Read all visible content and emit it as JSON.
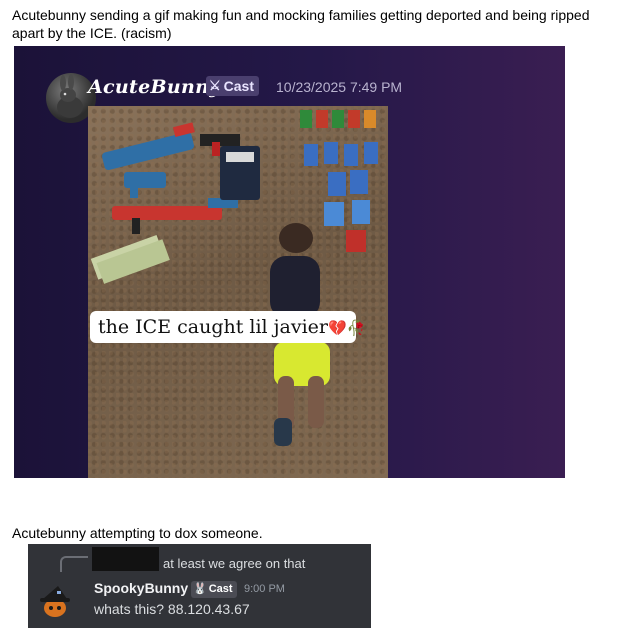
{
  "captions": {
    "first": "Acutebunny sending a gif making fun and mocking families getting deported and being ripped apart by the ICE. (racism)",
    "second": "Acutebunny attempting to dox someone."
  },
  "screenshot1": {
    "username": "AcuteBunny",
    "badge_label": "Cast",
    "badge_icon": "sword-icon",
    "timestamp": "10/23/2025 7:49 PM",
    "gif_caption": "the ICE caught lil javier",
    "gif_caption_emojis": "💔🥀",
    "colors": {
      "background": "#241848",
      "badge": "#4a3f6e"
    }
  },
  "screenshot2": {
    "reply_text": "at least we agree on that",
    "username": "SpookyBunny",
    "badge_label": "Cast",
    "badge_icon": "bunny-icon",
    "timestamp": "9:00 PM",
    "message": "whats this? 88.120.43.67",
    "colors": {
      "background": "#313338"
    }
  }
}
